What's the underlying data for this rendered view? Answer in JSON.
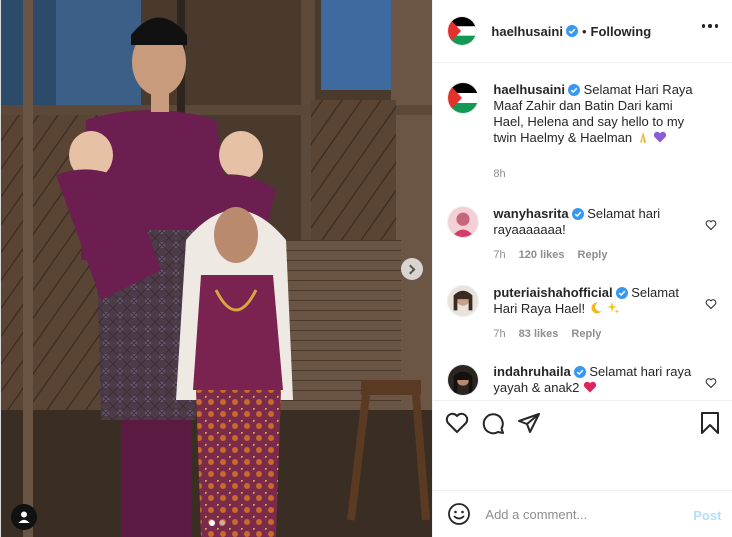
{
  "colors": {
    "accent": "#0095f6",
    "post_disabled": "#b2dffc",
    "muted": "#8e8e8e",
    "text": "#262626",
    "verified": "#3897f0",
    "flag_black": "#000000",
    "flag_white": "#ffffff",
    "flag_green": "#149954",
    "flag_red": "#e4312b",
    "outfit_purple": "#6b1e4f"
  },
  "photo": {
    "icons": {
      "next": "chevron-right-icon",
      "tag": "user-tag-icon"
    },
    "carousel_total": 2,
    "carousel_active": 1
  },
  "header": {
    "username": "haelhusaini",
    "separator": "•",
    "follow_label": "Following",
    "avatar_icon": "palestine-flag-avatar",
    "more_icon": "more-options-icon"
  },
  "caption": {
    "username": "haelhusaini",
    "text": "Selamat Hari Raya Maaf Zahir dan Batin Dari kami Hael, Helena and say hello to my twin Haelmy & Haelman",
    "emojis": [
      "folded-hands-emoji",
      "purple-heart-emoji"
    ],
    "time": "8h"
  },
  "comments": [
    {
      "username": "wanyhasrita",
      "text": "Selamat hari rayaaaaaaa!",
      "time": "7h",
      "likes": "120 likes",
      "reply": "Reply",
      "emojis": []
    },
    {
      "username": "puteriaishahofficial",
      "text": "Selamat Hari Raya Hael!",
      "time": "7h",
      "likes": "83 likes",
      "reply": "Reply",
      "emojis": [
        "crescent-moon-emoji",
        "sparkles-emoji"
      ]
    },
    {
      "username": "indahruhaila",
      "text": "Selamat hari raya yayah & anak2",
      "emojis": [
        "red-heart-emoji"
      ]
    }
  ],
  "actions": {
    "icons": [
      "like-icon",
      "comment-icon",
      "share-icon",
      "save-icon"
    ]
  },
  "add_comment": {
    "placeholder": "Add a comment...",
    "post_label": "Post",
    "icon": "emoji-smile-icon"
  }
}
